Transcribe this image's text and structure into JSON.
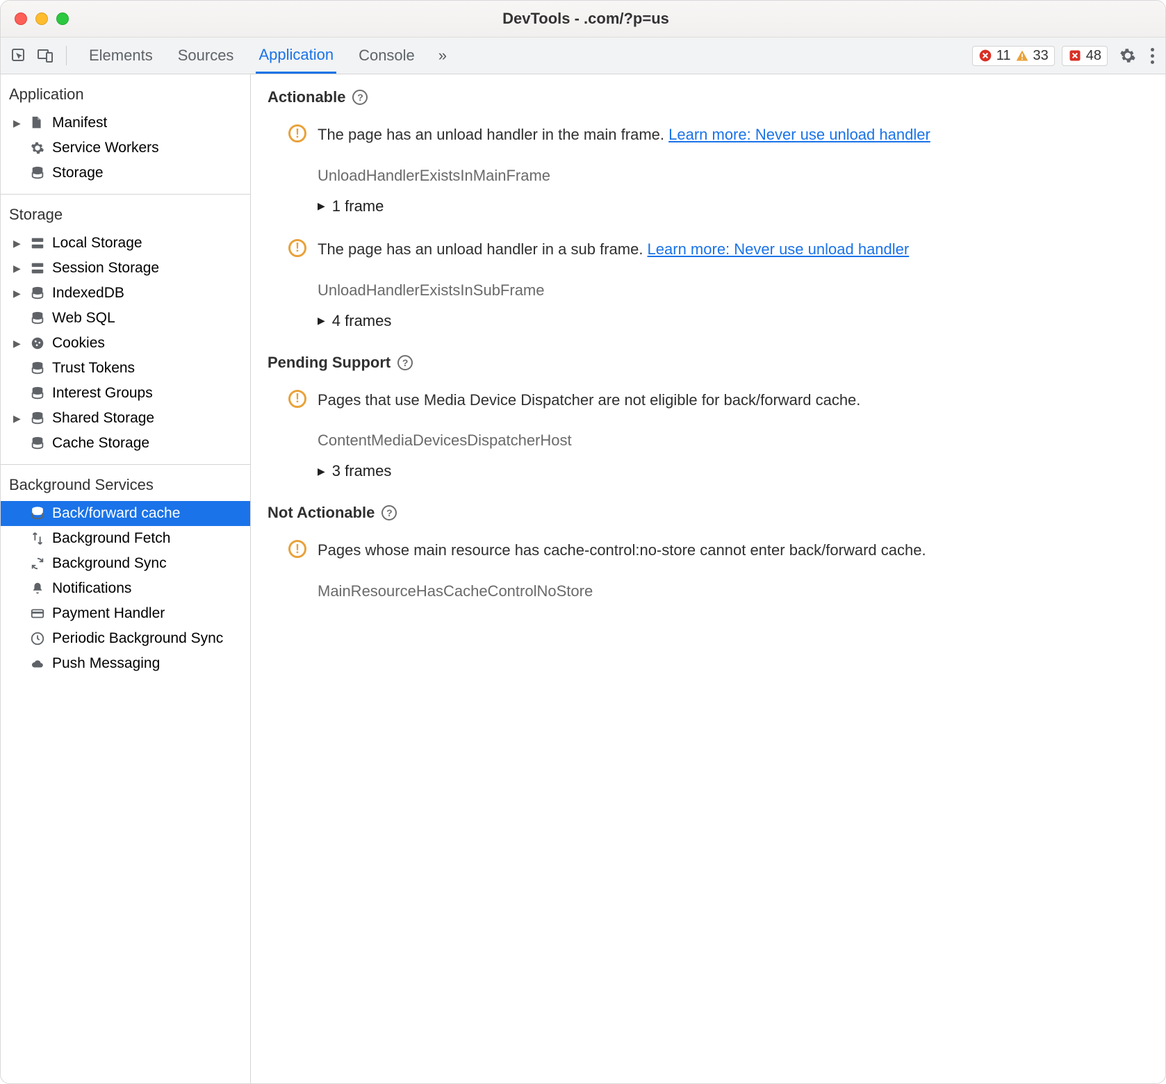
{
  "window": {
    "title": "DevTools -             .com/?p=us"
  },
  "tabs": {
    "items": [
      "Elements",
      "Sources",
      "Application",
      "Console"
    ],
    "active_index": 2
  },
  "badges": {
    "errors": 11,
    "warnings": 33,
    "issues": 48
  },
  "sidebar": {
    "sections": [
      {
        "header": "Application",
        "items": [
          {
            "id": "manifest",
            "label": "Manifest",
            "icon": "file",
            "expandable": true
          },
          {
            "id": "service-workers",
            "label": "Service Workers",
            "icon": "gear"
          },
          {
            "id": "storage",
            "label": "Storage",
            "icon": "database"
          }
        ]
      },
      {
        "header": "Storage",
        "items": [
          {
            "id": "local-storage",
            "label": "Local Storage",
            "icon": "table",
            "expandable": true
          },
          {
            "id": "session-storage",
            "label": "Session Storage",
            "icon": "table",
            "expandable": true
          },
          {
            "id": "indexeddb",
            "label": "IndexedDB",
            "icon": "database",
            "expandable": true
          },
          {
            "id": "web-sql",
            "label": "Web SQL",
            "icon": "database"
          },
          {
            "id": "cookies",
            "label": "Cookies",
            "icon": "cookie",
            "expandable": true
          },
          {
            "id": "trust-tokens",
            "label": "Trust Tokens",
            "icon": "database"
          },
          {
            "id": "interest-groups",
            "label": "Interest Groups",
            "icon": "database"
          },
          {
            "id": "shared-storage",
            "label": "Shared Storage",
            "icon": "database",
            "expandable": true
          },
          {
            "id": "cache-storage",
            "label": "Cache Storage",
            "icon": "database"
          }
        ]
      },
      {
        "header": "Background Services",
        "items": [
          {
            "id": "bfcache",
            "label": "Back/forward cache",
            "icon": "database",
            "selected": true
          },
          {
            "id": "background-fetch",
            "label": "Background Fetch",
            "icon": "updown"
          },
          {
            "id": "background-sync",
            "label": "Background Sync",
            "icon": "sync"
          },
          {
            "id": "notifications",
            "label": "Notifications",
            "icon": "bell"
          },
          {
            "id": "payment-handler",
            "label": "Payment Handler",
            "icon": "card"
          },
          {
            "id": "periodic-bg-sync",
            "label": "Periodic Background Sync",
            "icon": "clock"
          },
          {
            "id": "push-messaging",
            "label": "Push Messaging",
            "icon": "cloud"
          }
        ]
      }
    ]
  },
  "content": {
    "sections": [
      {
        "heading": "Actionable",
        "issues": [
          {
            "text": "The page has an unload handler in the main frame. ",
            "link": "Learn more: Never use unload handler",
            "code": "UnloadHandlerExistsInMainFrame",
            "frames": "1 frame"
          },
          {
            "text": "The page has an unload handler in a sub frame. ",
            "link": "Learn more: Never use unload handler",
            "code": "UnloadHandlerExistsInSubFrame",
            "frames": "4 frames"
          }
        ]
      },
      {
        "heading": "Pending Support",
        "issues": [
          {
            "text": "Pages that use Media Device Dispatcher are not eligible for back/forward cache.",
            "code": "ContentMediaDevicesDispatcherHost",
            "frames": "3 frames"
          }
        ]
      },
      {
        "heading": "Not Actionable",
        "issues": [
          {
            "text": "Pages whose main resource has cache-control:no-store cannot enter back/forward cache.",
            "code": "MainResourceHasCacheControlNoStore"
          }
        ]
      }
    ]
  }
}
